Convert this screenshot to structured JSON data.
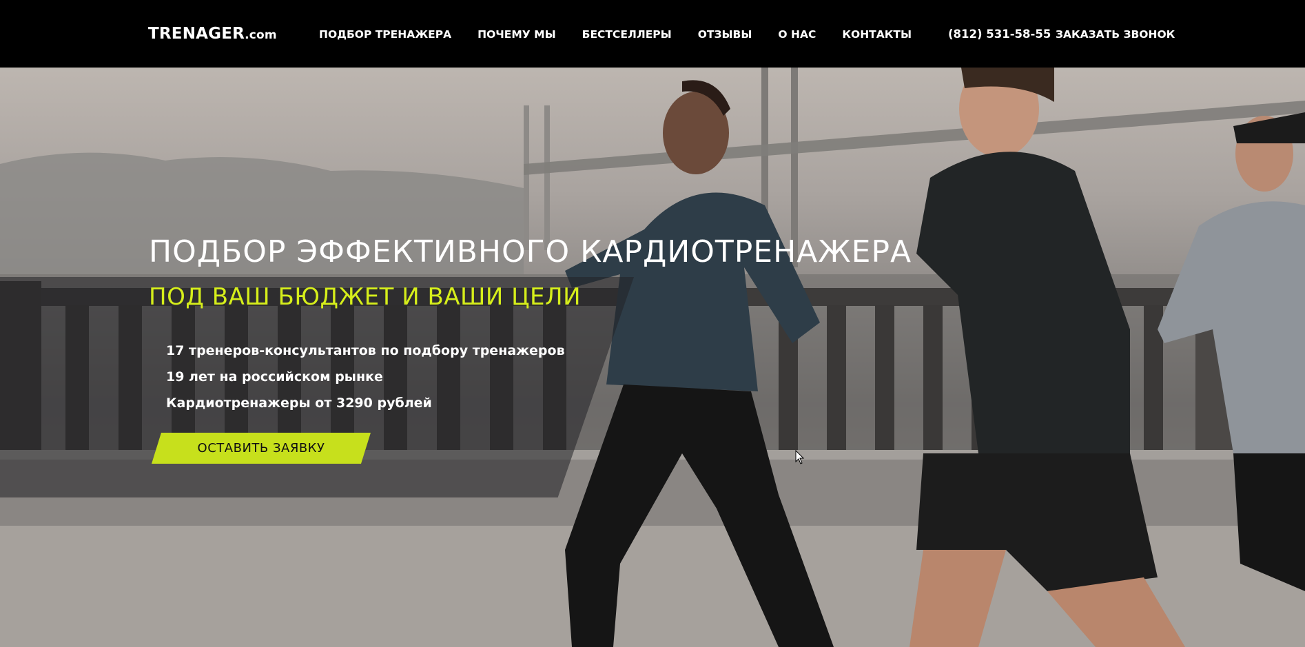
{
  "header": {
    "logo_main": "TRENAGER",
    "logo_domain": ".com",
    "nav": [
      {
        "label": "ПОДБОР ТРЕНАЖЕРА"
      },
      {
        "label": "ПОЧЕМУ МЫ"
      },
      {
        "label": "БЕСТСЕЛЛЕРЫ"
      },
      {
        "label": "ОТЗЫВЫ"
      },
      {
        "label": "О НАС"
      },
      {
        "label": "КОНТАКТЫ"
      }
    ],
    "phone": "(812) 531-58-55",
    "callback_label": "ЗАКАЗАТЬ ЗВОНОК"
  },
  "hero": {
    "title": "ПОДБОР ЭФФЕКТИВНОГО КАРДИОТРЕНАЖЕРА",
    "subtitle": "ПОД ВАШ БЮДЖЕТ И ВАШИ ЦЕЛИ",
    "features": [
      "17 тренеров-консультантов по подбору тренажеров",
      "19 лет на российском рынке",
      "Кардиотренажеры от 3290 рублей"
    ],
    "cta_label": "ОСТАВИТЬ ЗАЯВКУ"
  },
  "colors": {
    "header_bg": "#000000",
    "accent": "#c7e01c",
    "subtitle": "#d6ee1b",
    "text": "#ffffff"
  }
}
